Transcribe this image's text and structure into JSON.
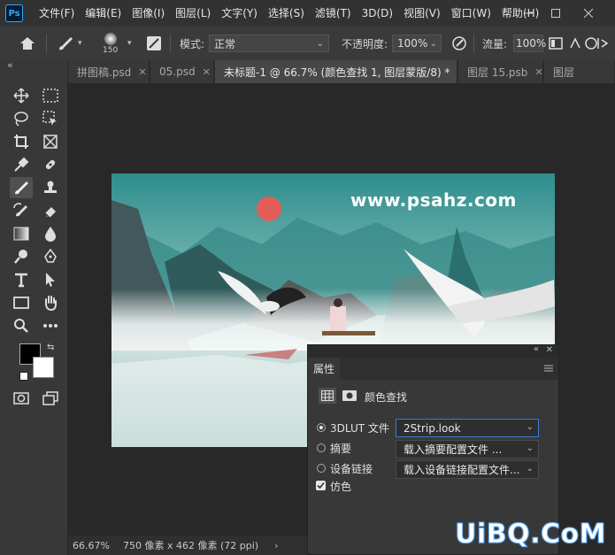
{
  "app": {
    "logo": "Ps"
  },
  "menu": [
    "文件(F)",
    "编辑(E)",
    "图像(I)",
    "图层(L)",
    "文字(Y)",
    "选择(S)",
    "滤镜(T)",
    "3D(D)",
    "视图(V)",
    "窗口(W)",
    "帮助(H)"
  ],
  "options": {
    "brush_size": "150",
    "mode_label": "模式:",
    "mode_value": "正常",
    "opacity_label": "不透明度:",
    "opacity_value": "100%",
    "flow_label": "流量:",
    "flow_value": "100%"
  },
  "collapse_glyph": "«",
  "tabs": [
    {
      "label": "拼图稿.psd",
      "active": false
    },
    {
      "label": "05.psd",
      "active": false
    },
    {
      "label": "未标题-1 @ 66.7% (颜色查找 1, 图层蒙版/8) *",
      "active": true
    },
    {
      "label": "图层 15.psb",
      "active": false
    },
    {
      "label": "图层",
      "active": false
    }
  ],
  "document": {
    "watermark_text": "www.psahz.com"
  },
  "status": {
    "zoom": "66.67%",
    "info": "750 像素 x 462 像素 (72 ppi)",
    "arrow": "›"
  },
  "panel": {
    "title": "属性",
    "adjustment_name": "颜色查找",
    "options": [
      {
        "label": "3DLUT 文件",
        "value": "2Strip.look",
        "checked": true
      },
      {
        "label": "摘要",
        "value": "载入摘要配置文件 ...",
        "checked": false
      },
      {
        "label": "设备链接",
        "value": "载入设备链接配置文件...",
        "checked": false
      }
    ],
    "dither_label": "仿色",
    "dither_checked": true
  },
  "site_watermark": "UiBQ.CoM",
  "colors": {
    "foreground": "#000000",
    "background": "#ffffff",
    "accent": "#31a8ff",
    "focus": "#3b7bd6"
  }
}
